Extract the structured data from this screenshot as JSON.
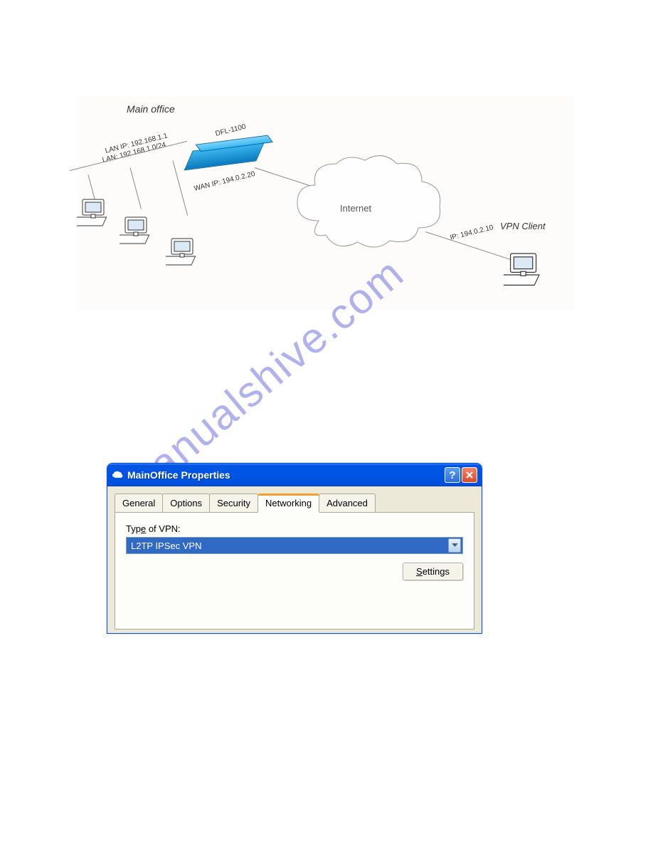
{
  "diagram": {
    "main_office": "Main office",
    "device": "DFL-1100",
    "lan_ip": "LAN IP: 192.168.1.1",
    "lan_net": "LAN: 192.168.1.0/24",
    "wan_ip": "WAN IP: 194.0.2.20",
    "internet": "Internet",
    "vpn_client": "VPN Client",
    "client_ip": "IP: 194.0.2.10"
  },
  "watermark": "manualshive.com",
  "dialog": {
    "title": "MainOffice Properties",
    "tabs": {
      "general": "General",
      "options": "Options",
      "security": "Security",
      "networking": "Networking",
      "advanced": "Advanced"
    },
    "vpn_type_label_pre": "Typ",
    "vpn_type_label_u": "e",
    "vpn_type_label_post": " of VPN:",
    "vpn_type_value": "L2TP IPSec VPN",
    "settings_u": "S",
    "settings_post": "ettings"
  }
}
